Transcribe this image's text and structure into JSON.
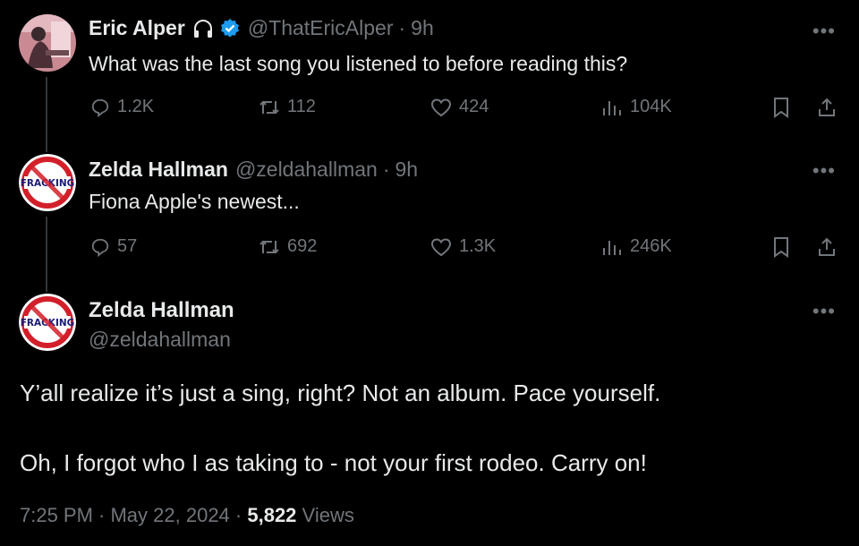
{
  "tweet1": {
    "name": "Eric Alper",
    "handle": "@ThatEricAlper",
    "separator": "·",
    "time": "9h",
    "text": "What was the last song you listened to before reading this?",
    "replies": "1.2K",
    "retweets": "112",
    "likes": "424",
    "views": "104K"
  },
  "tweet2": {
    "name": "Zelda Hallman",
    "handle": "@zeldahallman",
    "separator": "·",
    "time": "9h",
    "text": "Fiona Apple's newest...",
    "replies": "57",
    "retweets": "692",
    "likes": "1.3K",
    "views": "246K",
    "avatar_text": "FRACKING"
  },
  "tweet3": {
    "name": "Zelda Hallman",
    "handle": "@zeldahallman",
    "avatar_text": "FRACKING",
    "line1": "Y’all realize it’s just a sing, right? Not an album. Pace yourself.",
    "line2": "Oh, I forgot who I as taking to - not your first rodeo. Carry on!",
    "timestamp": "7:25 PM · May 22, 2024 ·",
    "view_count": "5,822",
    "views_label": "Views"
  },
  "colors": {
    "background": "#000000",
    "text": "#e7e9ea",
    "muted": "#71767b",
    "verified": "#1d9bf0"
  },
  "icons": [
    "headphones-icon",
    "verified-badge-icon",
    "more-icon",
    "reply-icon",
    "retweet-icon",
    "like-icon",
    "views-icon",
    "bookmark-icon",
    "share-icon"
  ]
}
